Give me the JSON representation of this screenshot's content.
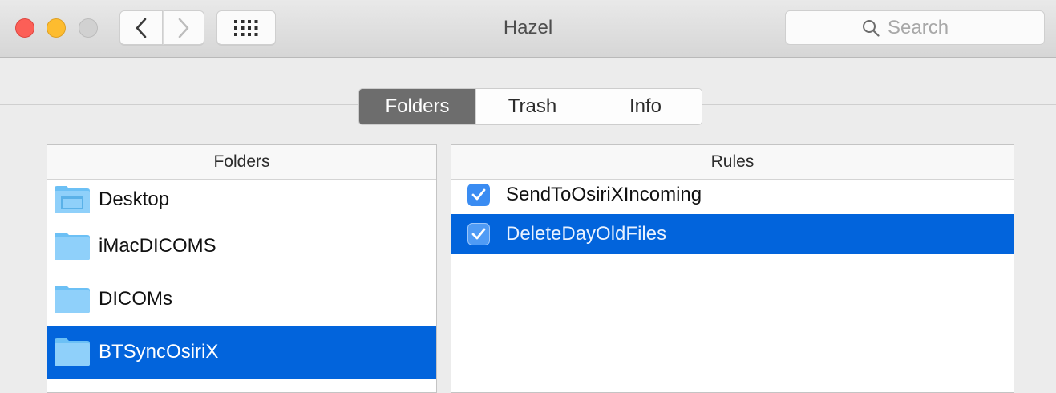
{
  "window": {
    "title": "Hazel"
  },
  "toolbar": {
    "search_placeholder": "Search",
    "search_value": ""
  },
  "tabs": [
    {
      "label": "Folders",
      "active": true
    },
    {
      "label": "Trash",
      "active": false
    },
    {
      "label": "Info",
      "active": false
    }
  ],
  "folders_panel": {
    "header": "Folders",
    "items": [
      {
        "label": "Desktop",
        "icon": "desktop-folder-icon",
        "selected": false
      },
      {
        "label": "iMacDICOMS",
        "icon": "folder-icon",
        "selected": false
      },
      {
        "label": "DICOMs",
        "icon": "folder-icon",
        "selected": false
      },
      {
        "label": "BTSyncOsiriX",
        "icon": "folder-icon",
        "selected": true
      }
    ]
  },
  "rules_panel": {
    "header": "Rules",
    "items": [
      {
        "label": "SendToOsiriXIncoming",
        "checked": true,
        "selected": false
      },
      {
        "label": "DeleteDayOldFiles",
        "checked": true,
        "selected": true
      }
    ]
  },
  "colors": {
    "selection": "#0264dc",
    "checkbox": "#3a8cf2",
    "close": "#fc5f57",
    "minimize": "#fdbc2f",
    "zoom_disabled": "#d1d1d1"
  }
}
